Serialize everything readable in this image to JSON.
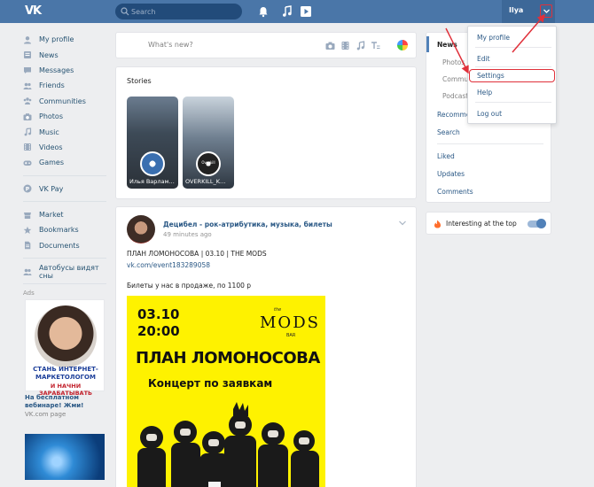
{
  "header": {
    "logo": "VK",
    "search_placeholder": "Search",
    "user_name": "Ilya"
  },
  "sidebar": {
    "items": [
      {
        "label": "My profile",
        "icon": "user-icon"
      },
      {
        "label": "News",
        "icon": "news-icon"
      },
      {
        "label": "Messages",
        "icon": "message-icon"
      },
      {
        "label": "Friends",
        "icon": "friends-icon"
      },
      {
        "label": "Communities",
        "icon": "communities-icon"
      },
      {
        "label": "Photos",
        "icon": "camera-icon"
      },
      {
        "label": "Music",
        "icon": "music-icon"
      },
      {
        "label": "Videos",
        "icon": "video-icon"
      },
      {
        "label": "Games",
        "icon": "gamepad-icon"
      }
    ],
    "pay": {
      "label": "VK Pay",
      "icon": "vkpay-icon"
    },
    "items2": [
      {
        "label": "Market",
        "icon": "market-icon"
      },
      {
        "label": "Bookmarks",
        "icon": "star-icon"
      },
      {
        "label": "Documents",
        "icon": "document-icon"
      }
    ],
    "community": {
      "label": "Автобусы видят сны",
      "icon": "group-icon"
    },
    "ads_label": "Ads",
    "ad1": {
      "line1": "СТАНЬ ИНТЕРНЕТ-",
      "line2": "МАРКЕТОЛОГОМ",
      "line3": "И НАЧНИ ЗАРАБАТЫВАТЬ",
      "title": "На бесплатном вебинаре! Жми!",
      "source": "VK.com page"
    }
  },
  "composer": {
    "placeholder": "What's new?"
  },
  "stories": {
    "title": "Stories",
    "items": [
      {
        "name": "Илья Варлам…",
        "badge": ""
      },
      {
        "name": "OVERKILL_K…",
        "badge": "Overkill"
      }
    ]
  },
  "post": {
    "author": "Децибел - рок-атрибутика, музыка, билеты",
    "time": "49 minutes ago",
    "text1": "ПЛАН ЛОМОНОСОВА | 03.10 | THE MODS",
    "link": "vk.com/event183289058",
    "text2": "Билеты у нас в продаже, по 1100 р",
    "poster": {
      "date": "03.10",
      "time": "20:00",
      "brand_small": "the",
      "brand": "MODS",
      "bar": "BAR",
      "title": "ПЛАН ЛОМОНОСОВА",
      "subtitle": "Концерт по заявкам"
    }
  },
  "right_nav": {
    "items": [
      "News",
      "Photos",
      "Communities",
      "Podcasts",
      "Recommendations",
      "Search",
      "Liked",
      "Updates",
      "Comments"
    ]
  },
  "interesting": {
    "label": "Interesting at the top",
    "enabled": true
  },
  "dropdown": {
    "items": [
      "My profile",
      "Edit",
      "Settings",
      "Help",
      "Log out"
    ]
  },
  "colors": {
    "header": "#4a76a8",
    "link": "#2a5885",
    "annotation": "#e0303a",
    "poster": "#fef200"
  }
}
